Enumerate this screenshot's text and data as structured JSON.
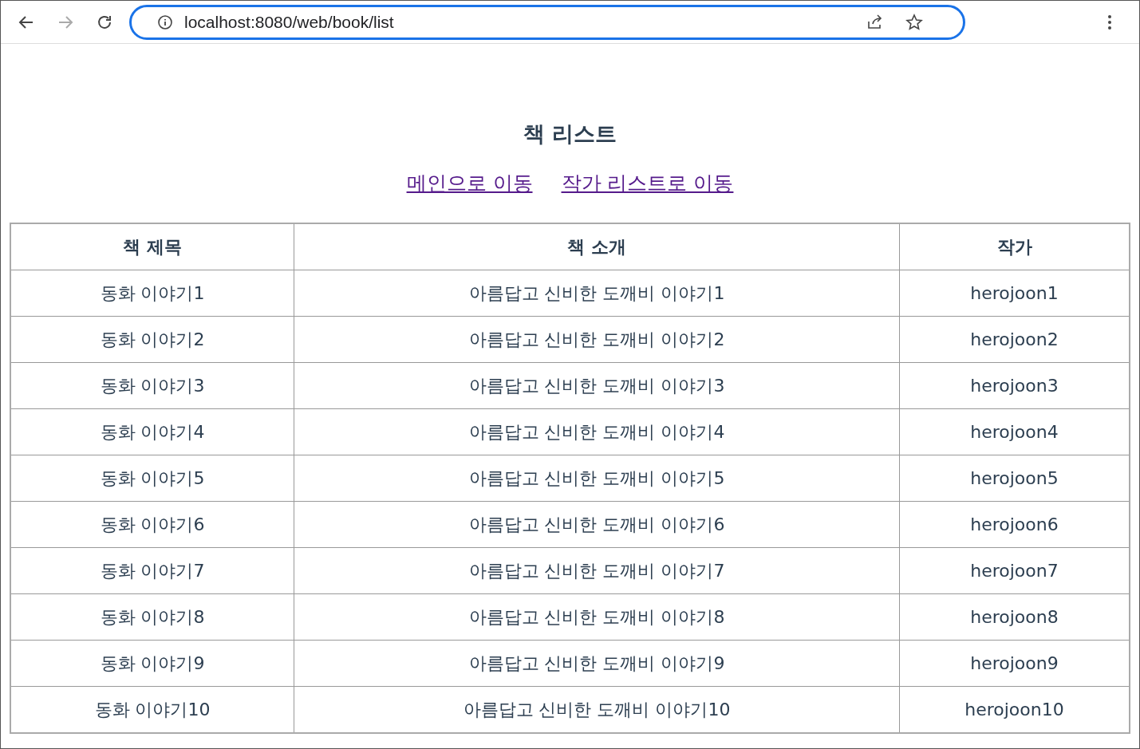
{
  "browser": {
    "url": "localhost:8080/web/book/list"
  },
  "page": {
    "title": "책 리스트",
    "links": [
      {
        "label": "메인으로 이동"
      },
      {
        "label": "작가 리스트로 이동"
      }
    ]
  },
  "table": {
    "columns": [
      "책 제목",
      "책 소개",
      "작가"
    ],
    "rows": [
      [
        "동화 이야기1",
        "아름답고 신비한 도깨비 이야기1",
        "herojoon1"
      ],
      [
        "동화 이야기2",
        "아름답고 신비한 도깨비 이야기2",
        "herojoon2"
      ],
      [
        "동화 이야기3",
        "아름답고 신비한 도깨비 이야기3",
        "herojoon3"
      ],
      [
        "동화 이야기4",
        "아름답고 신비한 도깨비 이야기4",
        "herojoon4"
      ],
      [
        "동화 이야기5",
        "아름답고 신비한 도깨비 이야기5",
        "herojoon5"
      ],
      [
        "동화 이야기6",
        "아름답고 신비한 도깨비 이야기6",
        "herojoon6"
      ],
      [
        "동화 이야기7",
        "아름답고 신비한 도깨비 이야기7",
        "herojoon7"
      ],
      [
        "동화 이야기8",
        "아름답고 신비한 도깨비 이야기8",
        "herojoon8"
      ],
      [
        "동화 이야기9",
        "아름답고 신비한 도깨비 이야기9",
        "herojoon9"
      ],
      [
        "동화 이야기10",
        "아름답고 신비한 도깨비 이야기10",
        "herojoon10"
      ]
    ]
  }
}
